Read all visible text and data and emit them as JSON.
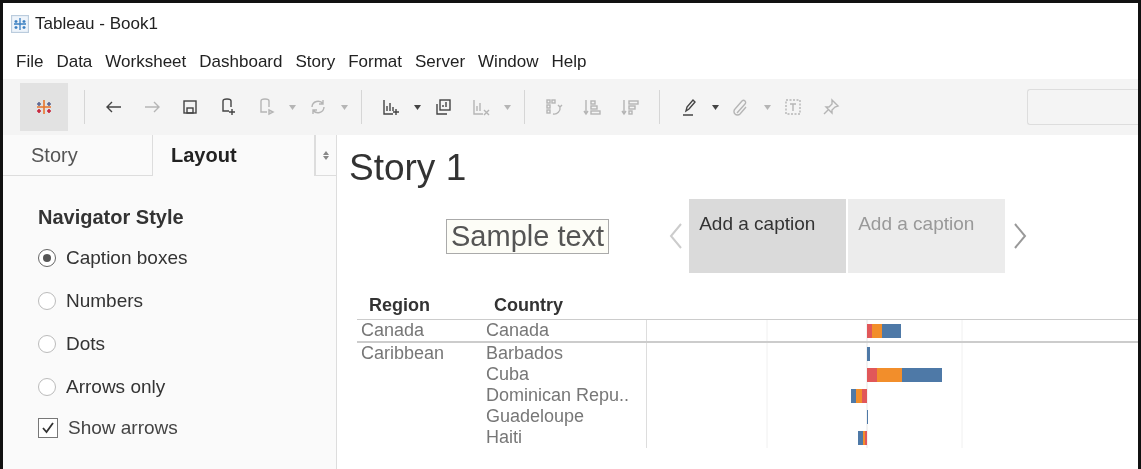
{
  "window": {
    "title": "Tableau - Book1"
  },
  "menu": [
    "File",
    "Data",
    "Worksheet",
    "Dashboard",
    "Story",
    "Format",
    "Server",
    "Window",
    "Help"
  ],
  "toolbar": [
    {
      "kind": "logo",
      "disabled": false
    },
    {
      "kind": "sep",
      "disabled": false
    },
    {
      "kind": "back",
      "disabled": false
    },
    {
      "kind": "forward",
      "disabled": true
    },
    {
      "kind": "save",
      "disabled": false
    },
    {
      "kind": "add-data",
      "disabled": false
    },
    {
      "kind": "run-data",
      "disabled": true
    },
    {
      "kind": "drop",
      "disabled": true
    },
    {
      "kind": "refresh",
      "disabled": true
    },
    {
      "kind": "drop",
      "disabled": true
    },
    {
      "kind": "sep",
      "disabled": false
    },
    {
      "kind": "new-sheet",
      "disabled": false
    },
    {
      "kind": "drop",
      "disabled": false
    },
    {
      "kind": "duplicate",
      "disabled": false
    },
    {
      "kind": "clear",
      "disabled": true
    },
    {
      "kind": "drop",
      "disabled": true
    },
    {
      "kind": "sep",
      "disabled": false
    },
    {
      "kind": "swap",
      "disabled": true
    },
    {
      "kind": "sort-asc",
      "disabled": true
    },
    {
      "kind": "sort-desc",
      "disabled": true
    },
    {
      "kind": "sep",
      "disabled": false
    },
    {
      "kind": "highlight",
      "disabled": false
    },
    {
      "kind": "drop",
      "disabled": false
    },
    {
      "kind": "clip",
      "disabled": true
    },
    {
      "kind": "drop",
      "disabled": true
    },
    {
      "kind": "text",
      "disabled": true
    },
    {
      "kind": "pin",
      "disabled": true
    }
  ],
  "panel": {
    "tabs": [
      {
        "label": "Story",
        "selected": false
      },
      {
        "label": "Layout",
        "selected": true
      }
    ],
    "heading": "Navigator Style",
    "options": [
      {
        "label": "Caption boxes",
        "selected": true
      },
      {
        "label": "Numbers",
        "selected": false
      },
      {
        "label": "Dots",
        "selected": false
      },
      {
        "label": "Arrows only",
        "selected": false
      }
    ],
    "show_arrows": {
      "label": "Show arrows",
      "checked": true
    }
  },
  "story": {
    "title": "Story 1",
    "text_object": "Sample text",
    "captions": [
      {
        "label": "Add a caption",
        "selected": true
      },
      {
        "label": "Add a caption",
        "selected": false
      }
    ]
  },
  "table": {
    "columns": [
      "Region",
      "Country"
    ],
    "groups": [
      {
        "region": "Canada",
        "countries": [
          "Canada"
        ]
      },
      {
        "region": "Caribbean",
        "countries": [
          "Barbados",
          "Cuba",
          "Dominican Repu..",
          "Guadeloupe",
          "Haiti"
        ]
      }
    ]
  }
}
